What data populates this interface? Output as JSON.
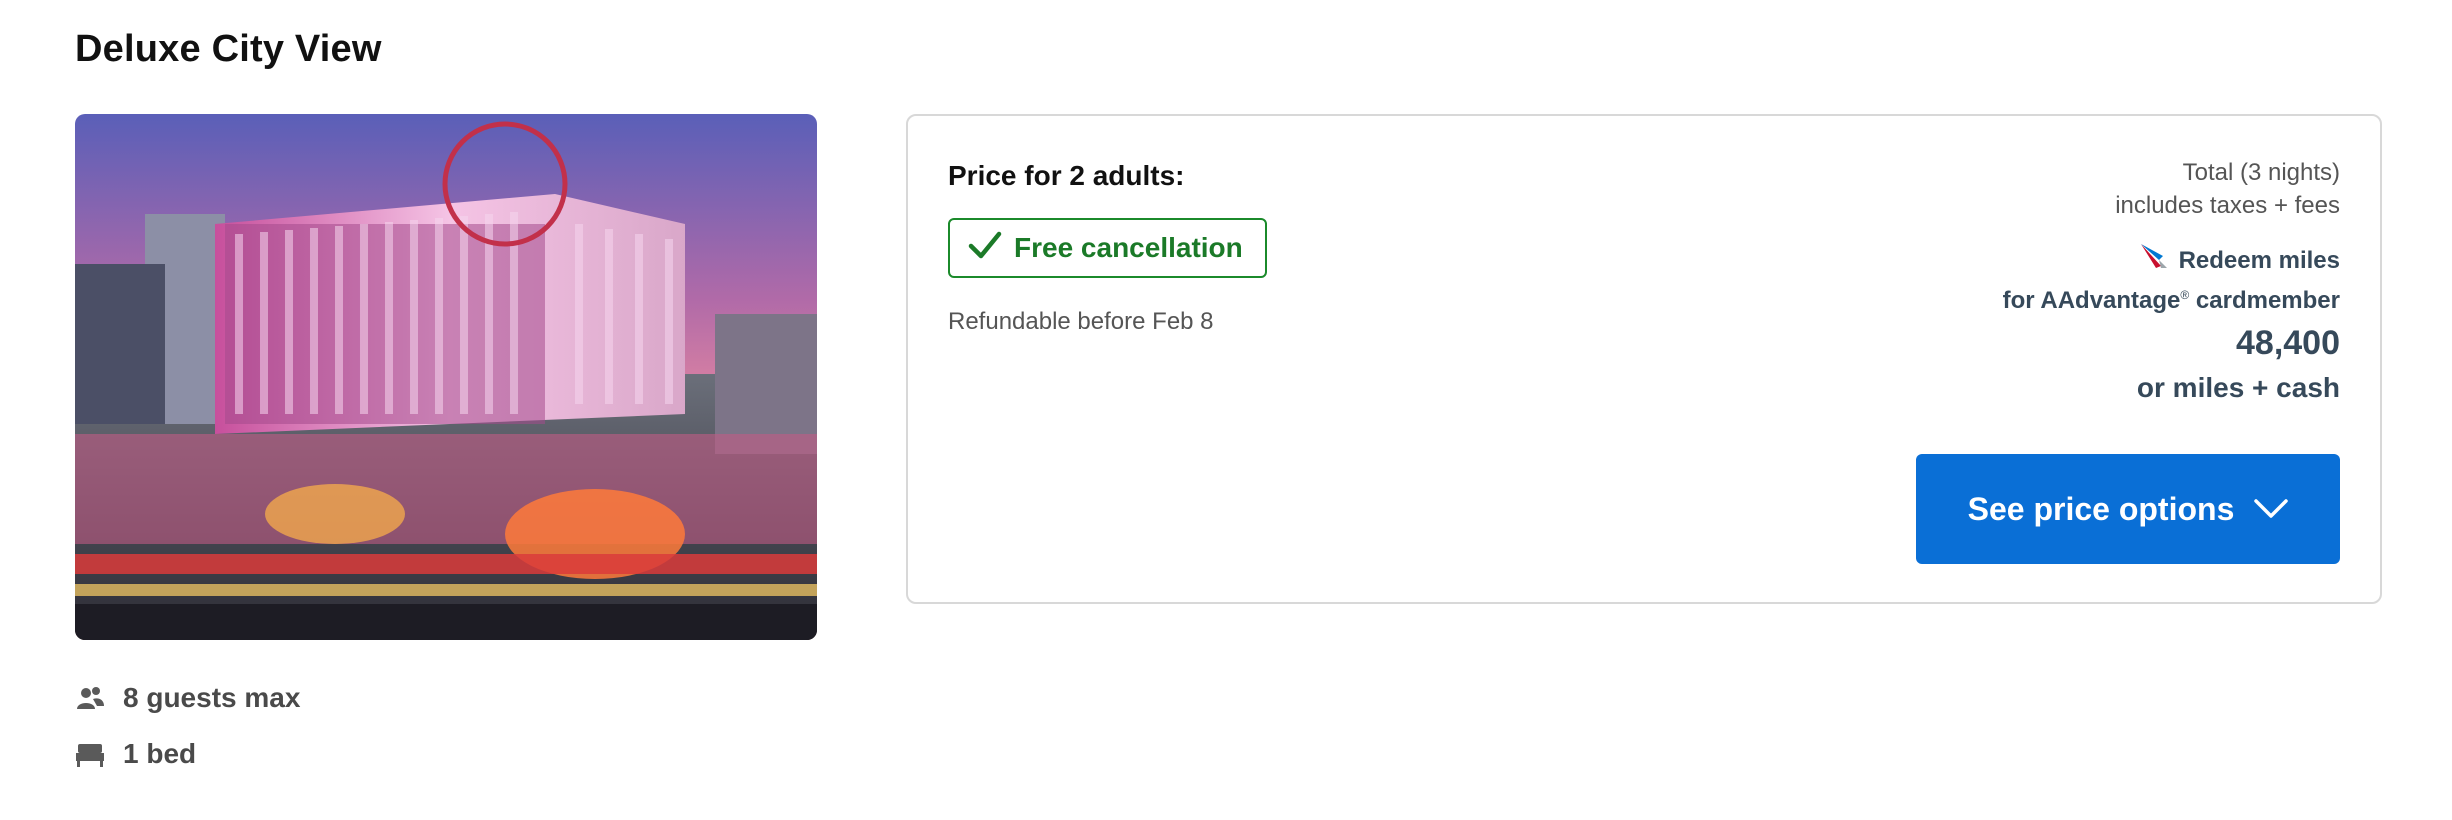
{
  "room": {
    "title": "Deluxe City View",
    "photo_alt": "Hotel exterior at dusk",
    "features": {
      "guests": "8 guests max",
      "beds": "1 bed"
    }
  },
  "pricing": {
    "heading": "Price for 2 adults:",
    "free_cancellation": "Free cancellation",
    "refundable": "Refundable before Feb 8",
    "total_label": "Total (3 nights)",
    "taxes_label": "includes taxes + fees",
    "redeem_label": "Redeem miles",
    "cardmember_prefix": "for AAdvantage",
    "cardmember_mark": "®",
    "cardmember_suffix": " cardmember",
    "miles_value": "48,400",
    "miles_cash": "or miles + cash",
    "see_price_button": "See price options"
  },
  "icons": {
    "guests": "guests-icon",
    "bed": "bed-icon",
    "check": "checkmark-icon",
    "airline": "airline-logo-icon",
    "chevron": "chevron-down-icon"
  },
  "colors": {
    "primary_button": "#0a6fd6",
    "free_cancel_green": "#1b7a28",
    "miles_text": "#36495a"
  }
}
